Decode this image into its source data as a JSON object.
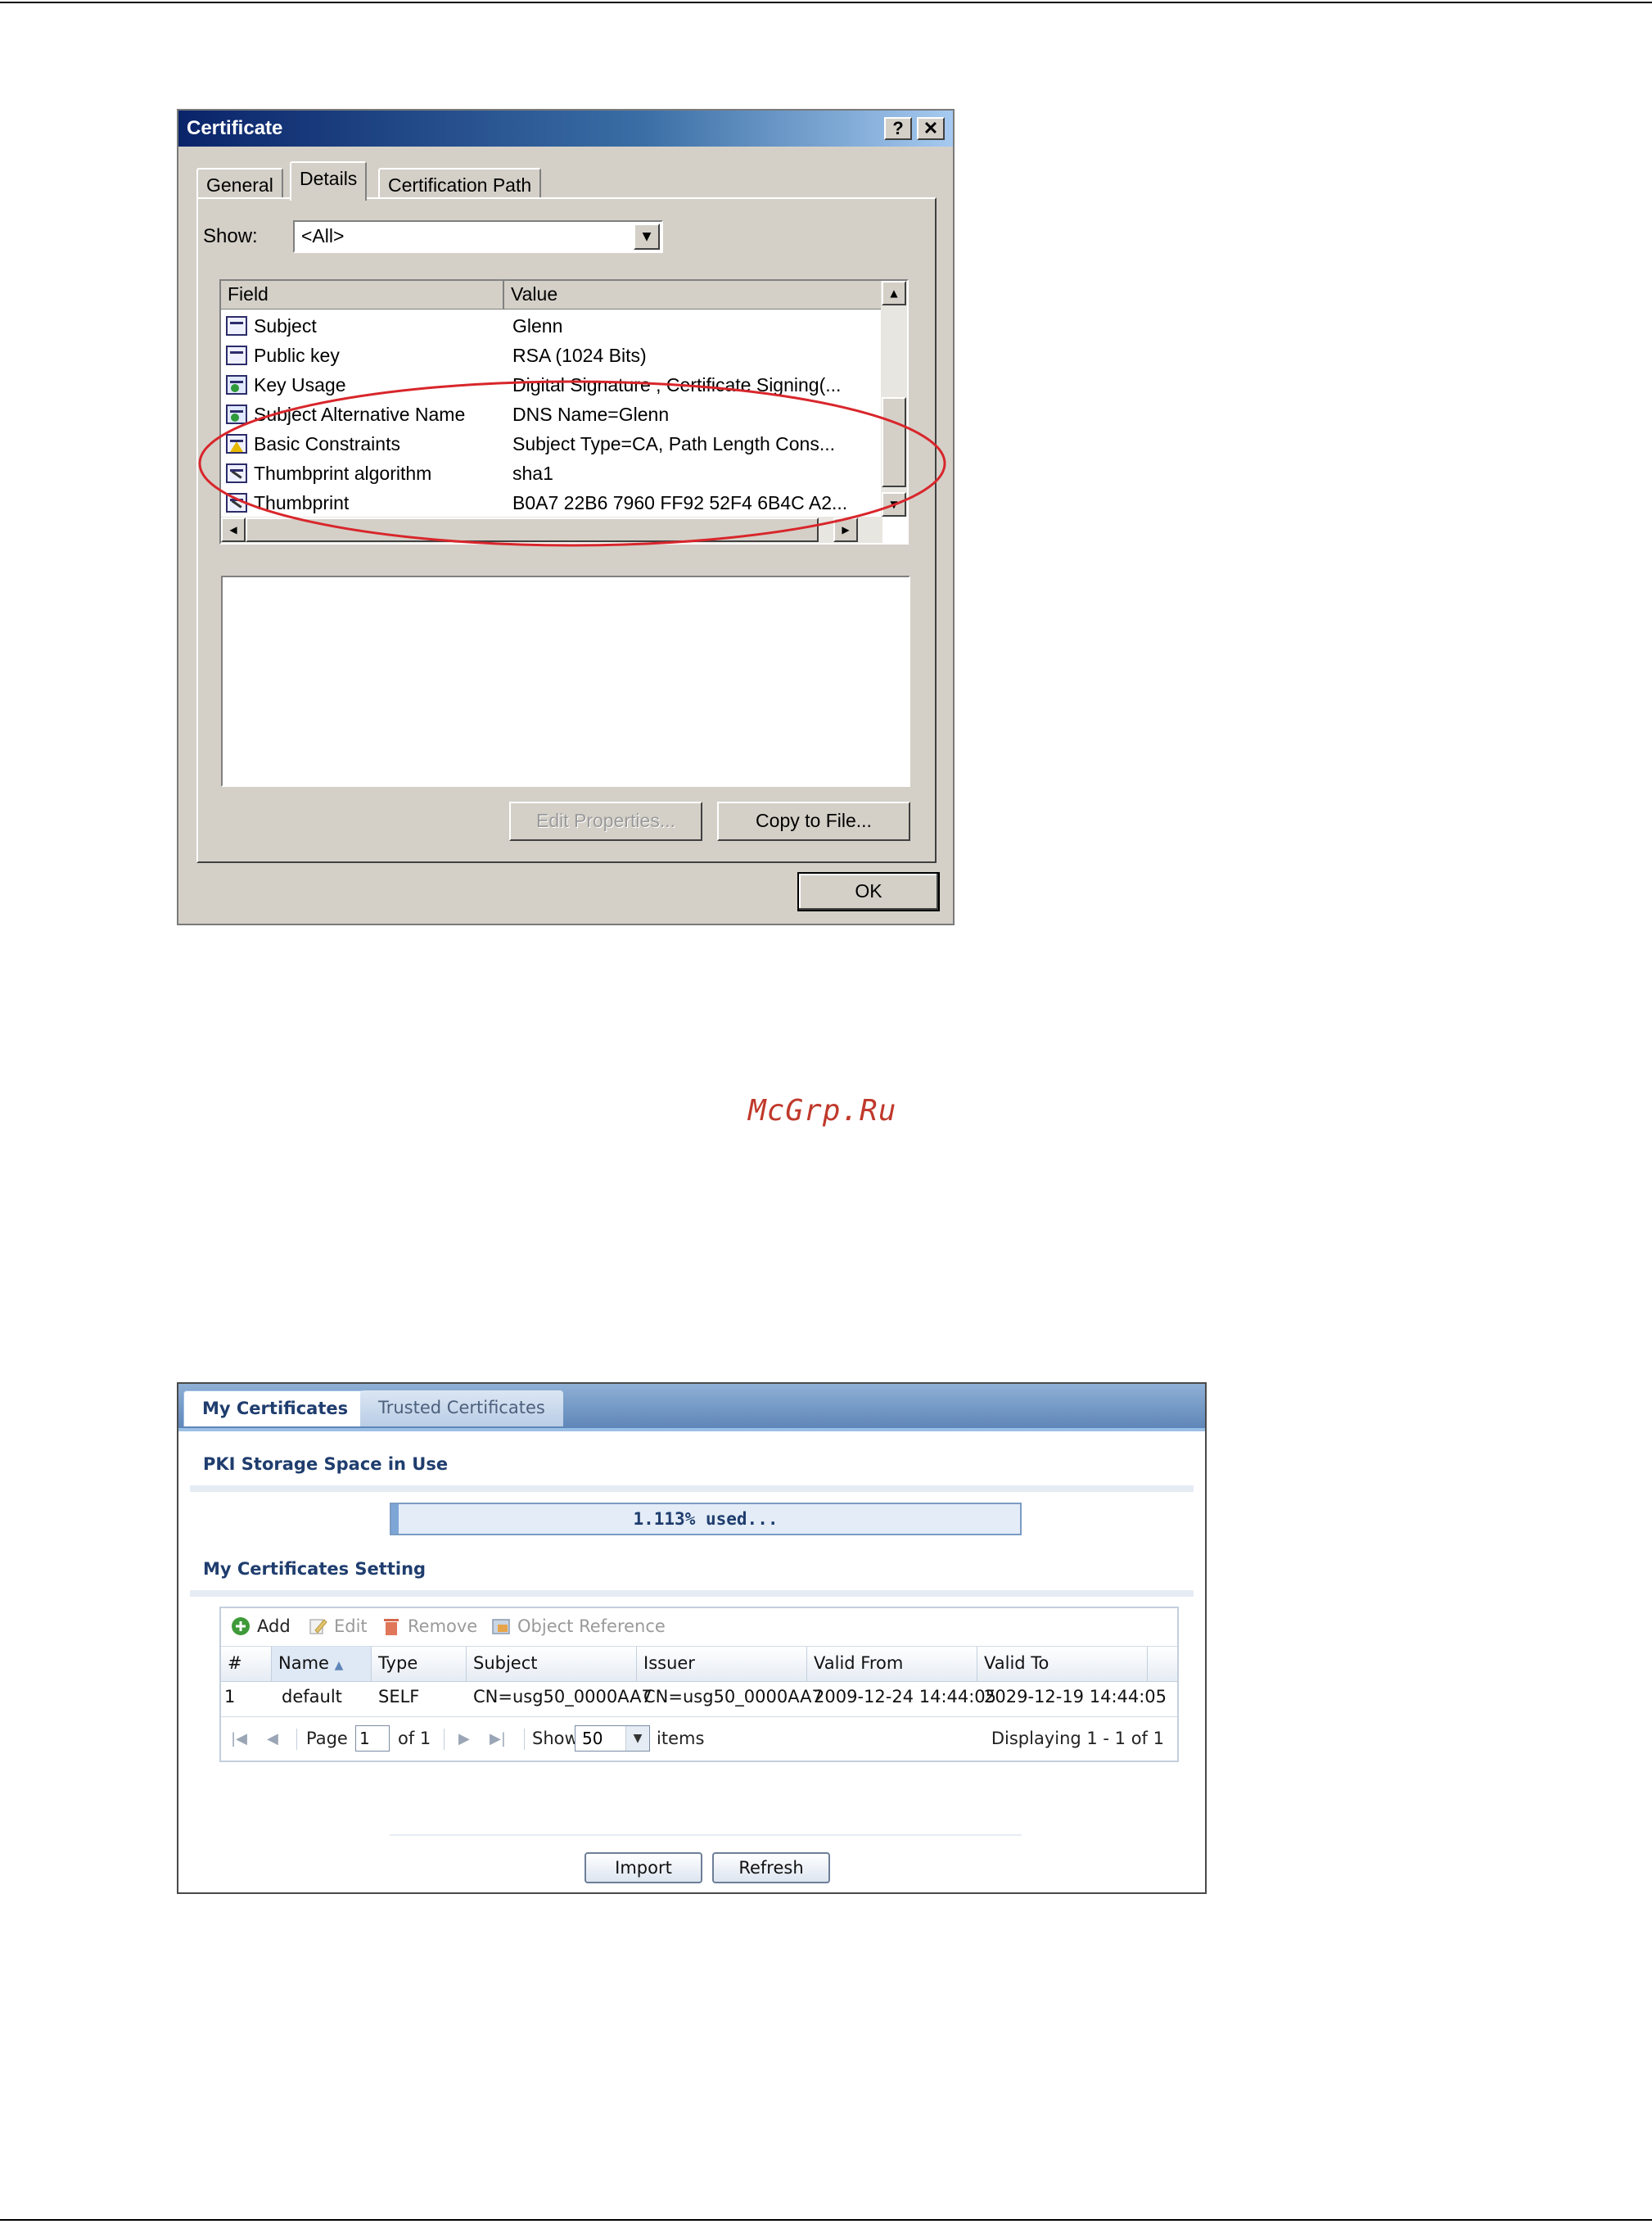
{
  "certificate_dialog": {
    "title": "Certificate",
    "help_label": "?",
    "close_label": "✕",
    "tabs": [
      {
        "label": "General"
      },
      {
        "label": "Details"
      },
      {
        "label": "Certification Path"
      }
    ],
    "show_label": "Show:",
    "show_value": "<All>",
    "columns": {
      "field": "Field",
      "value": "Value"
    },
    "rows": [
      {
        "field": "Subject",
        "value": "Glenn",
        "icon": "certificate-field-icon"
      },
      {
        "field": "Public key",
        "value": "RSA (1024 Bits)",
        "icon": "certificate-field-icon"
      },
      {
        "field": "Key Usage",
        "value": "Digital Signature , Certificate Signing(...",
        "icon": "certificate-extension-icon"
      },
      {
        "field": "Subject Alternative Name",
        "value": "DNS Name=Glenn",
        "icon": "certificate-extension-icon"
      },
      {
        "field": "Basic Constraints",
        "value": "Subject Type=CA, Path Length Cons...",
        "icon": "certificate-critical-extension-icon"
      },
      {
        "field": "Thumbprint algorithm",
        "value": "sha1",
        "icon": "certificate-property-icon"
      },
      {
        "field": "Thumbprint",
        "value": "B0A7 22B6 7960 FF92 52F4 6B4C A2...",
        "icon": "certificate-property-icon"
      }
    ],
    "edit_properties_label": "Edit Properties...",
    "copy_to_file_label": "Copy to File...",
    "ok_label": "OK"
  },
  "watermark": "McGrp.Ru",
  "my_certificates_panel": {
    "tabs": [
      {
        "label": "My Certificates"
      },
      {
        "label": "Trusted Certificates"
      }
    ],
    "storage_title": "PKI Storage Space in Use",
    "storage_used_text": "1.113% used...",
    "storage_used_percent": 1.113,
    "setting_title": "My Certificates Setting",
    "toolbar": {
      "add": "Add",
      "edit": "Edit",
      "remove": "Remove",
      "object_reference": "Object Reference"
    },
    "columns": {
      "num": "#",
      "name": "Name",
      "type": "Type",
      "subject": "Subject",
      "issuer": "Issuer",
      "valid_from": "Valid From",
      "valid_to": "Valid To"
    },
    "row": {
      "num": "1",
      "name": "default",
      "type": "SELF",
      "subject": "CN=usg50_0000AA7",
      "issuer": "CN=usg50_0000AA7",
      "valid_from": "2009-12-24 14:44:05",
      "valid_to": "2029-12-19 14:44:05"
    },
    "pager": {
      "page_label": "Page",
      "page_value": "1",
      "of_label": "of 1",
      "show_label": "Show",
      "show_value": "50",
      "items_label": "items",
      "displaying": "Displaying 1 - 1 of 1"
    },
    "import_label": "Import",
    "refresh_label": "Refresh",
    "colors": {
      "accent": "#1f3d6e",
      "tab_bar": "#5f86b8",
      "usage_fill": "#7da5d6"
    }
  }
}
